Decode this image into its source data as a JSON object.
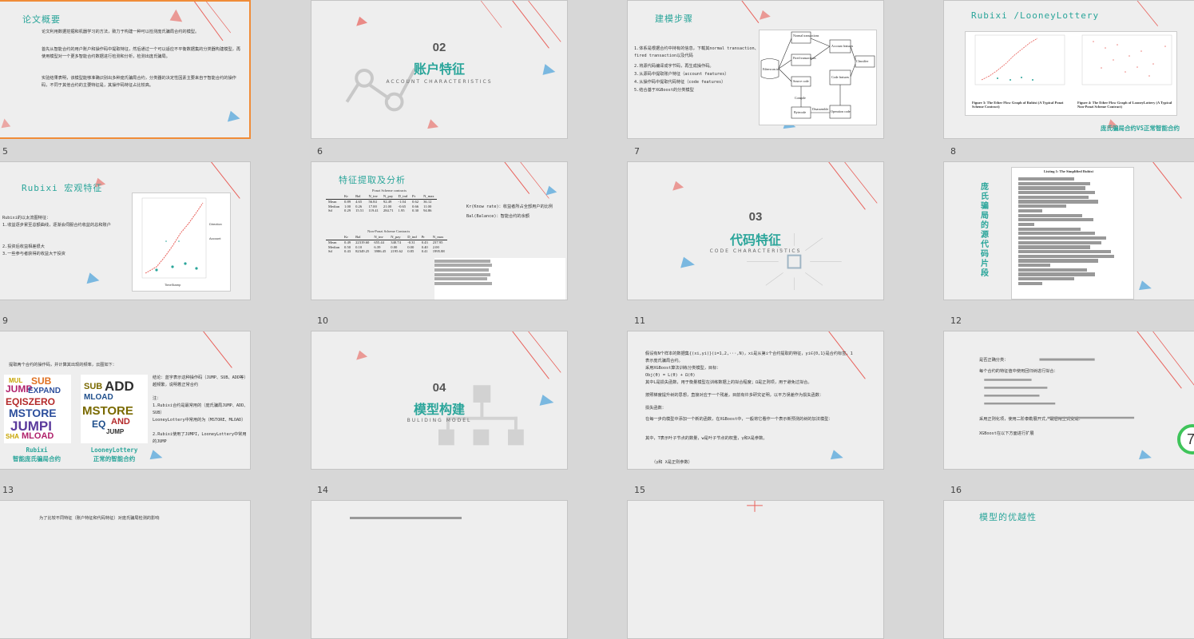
{
  "slides": {
    "s5": {
      "number": "5",
      "title": "论文概要",
      "paragraphs": [
        "论文利用数据挖掘和机器学习的方法，致力于构建一种可以检测庞氏骗局合约的模型。",
        "首先从智能合约的用户账户和操作码中提取特征，然后通过一个可以适应不平衡数据集的分类器构建模型，再使用模型对一个更多智能合约数据进行检测和分析，检测出庞氏骗局。",
        "实验结果表明，该模型能够准确识别出多种庞氏骗局合约，分类器的决定性因素主要来自于智能合约的操作码，不同于其他合约的主要特征是，其操作码特征占比较高。"
      ]
    },
    "s6": {
      "number": "6",
      "sec": "02",
      "title": "账户特征",
      "sub": "ACCOUNT CHARACTERISTICS"
    },
    "s7": {
      "number": "7",
      "title": "建模步骤",
      "steps": [
        "1.体系是根据合约中持有的信息，下载其normal transaction、fired transaction以及代码",
        "2.将源代码编译成字节码，再生成操作码。",
        "3.从源码中提取账户特征（account features）",
        "4.从操作码中提取代码特征（code features）",
        "5.结合基于XGBoost的分类模型"
      ],
      "diagram": {
        "source": "Etherscan.io",
        "nodes": [
          "Normal transactions",
          "Fired transactions",
          "Source code",
          "Compile",
          "Bytecode",
          "Disassemble",
          "Opcodes",
          "Account features",
          "Code features",
          "Operation code",
          "Classifier"
        ]
      }
    },
    "s8": {
      "number": "8",
      "title": "Rubixi /LooneyLottery",
      "fig1": "Figure 3: The Ether Flow Graph of Rubixi (A Typical Ponzi Scheme Contract)",
      "fig2": "Figure 4: The Ether Flow Graph of LooneyLottery (A Typical Non-Ponzi Scheme Contract)",
      "caption": "庞氏骗局合约VS正常智能合约"
    },
    "s9": {
      "number": "9",
      "title": "Rubixi 宏观特征",
      "lines": [
        "Rubixi的以太流图特征：",
        "1.收益逐步累至总额曲线，逐渐会伺服合约收益的总和账户",
        "2.投资后收益相差很大",
        "3.一些参与者获得的收益大于投资"
      ],
      "chart_legend": [
        "Direction",
        "Account"
      ],
      "xlabel": "TimeStamp",
      "ylabel": "Participants"
    },
    "s10": {
      "number": "10",
      "title": "特征提取及分析",
      "ponzi_caption": "Ponzi Scheme contracts",
      "nonponzi_caption": "Non-Ponzi Scheme Contracts",
      "headers": [
        "",
        "Kr",
        "Bal",
        "N_inv",
        "N_pay",
        "D_ind",
        "Pr",
        "N_max"
      ],
      "ponzi_rows": [
        [
          "Mean",
          "0.89",
          "4.65",
          "56.84",
          "92.49",
          "-1.04",
          "0.62",
          "36.12"
        ],
        [
          "Median",
          "1.00",
          "0.26",
          "17.00",
          "21.00",
          "-0.65",
          "0.66",
          "11.00"
        ],
        [
          "Sd",
          "0.29",
          "15.51",
          "119.41",
          "284.71",
          "1.95",
          "0.30",
          "94.86"
        ]
      ],
      "nonponzi_rows": [
        [
          "Mean",
          "0.49",
          "22319.60",
          "655.44",
          "340.74",
          "-0.31",
          "0.43",
          "237.95"
        ],
        [
          "Median",
          "0.50",
          "0.10",
          "6.39",
          "0.00",
          "0.00",
          "0.40",
          "2.00"
        ],
        [
          "Sd",
          "0.43",
          "82349.25",
          "3986.45",
          "2195.62",
          "0.85",
          "0.41",
          "1995.88"
        ]
      ],
      "notes": [
        "Kr(Know rate)：收益者所占全部用户的比例",
        "Bal(Balance)：智能合约的余额"
      ]
    },
    "s11": {
      "number": "11",
      "sec": "03",
      "title": "代码特征",
      "sub": "CODE CHARACTERISTICS"
    },
    "s12": {
      "number": "12",
      "vertical_title": "庞氏骗局的源代码片段",
      "listing_title": "Listing 1: The Simplified Rubixi"
    },
    "s13": {
      "number": "13",
      "intro": "提取两个合约的操作码，并计算其出现的频率，云图如下：",
      "side_notes": [
        "结论：蓝字表示这种操作码（JUMP、SUB、ADD等）越频繁，说明着正常合约",
        "注：",
        "1.Rubixi合约是最常用的（庞氏骗局JUMP、ADD、SUB）",
        "LooneyLottery中常用的为（MSTORE、MLOAD）",
        "2.Rubixi使用了JUMPI，LooneyLottery中常用的JUMP"
      ],
      "label1": "Rubixi",
      "label1b": "智能庞氏骗局合约",
      "label2": "LooneyLottery",
      "label2b": "正常的智能合约",
      "cloud1": [
        "MUL",
        "SUB",
        "JUMP",
        "EXPAND",
        "EQISZERO",
        "MSTORE",
        "JUMPI",
        "SHA",
        "MLOAD"
      ],
      "cloud2": [
        "SUB",
        "ADD",
        "MLOAD",
        "MSTORE",
        "EQ",
        "AND",
        "JUMP"
      ]
    },
    "s14": {
      "number": "14",
      "sec": "04",
      "title": "模型构建",
      "sub": "BULIDING MODEL"
    },
    "s15": {
      "number": "15",
      "lines": [
        "假设有N个样本的数据集{(xi,yi)}(i=1,2,···,N)，xi是从第i个合约提取的特征，yi∈{0,1}是合约标签，1表示庞氏骗局合约。",
        "采用XGBoost算法训练分类模型，目标：",
        "Obj(θ) = L(θ) + Ω(θ)",
        "其中L是损失函数，用于衡量模型在训练数据上的拟合程度；Ω是正则项，用于避免过拟合。",
        "按照梯度提升树的思想，直接对应于一个残差，目前有许多研究证明，以平方误差作为损失函数：",
        "损失函数：",
        "在每一步向模型中添加一个新的函数，在XGBoost中，一般将它看作一个表示新预测的树的加法模型：",
        "其中，T表示叶子节点的数量，w是叶子节点的权重，γ和λ是参数。",
        "（γ和 λ是正则参数）"
      ]
    },
    "s16": {
      "number": "16",
      "lines": [
        "是否正确分类：",
        "每个合约的特征值中使用回归树进行拟合：",
        "采用正则化项，使用二阶泰勒展开式，最后用上式变成：",
        "XGBoost在以下方面进行扩展"
      ]
    },
    "bottom": {
      "b1": "为了比较不同特征（账户特征和代码特征）对庞氏骗局检测的影响",
      "b4": "模型的优越性"
    }
  },
  "badge": {
    "text": "7"
  },
  "colors": {
    "accent": "#2aa59a",
    "selected": "#f08c38",
    "deco_red": "#e8605a",
    "deco_blue": "#7ab8e0"
  }
}
